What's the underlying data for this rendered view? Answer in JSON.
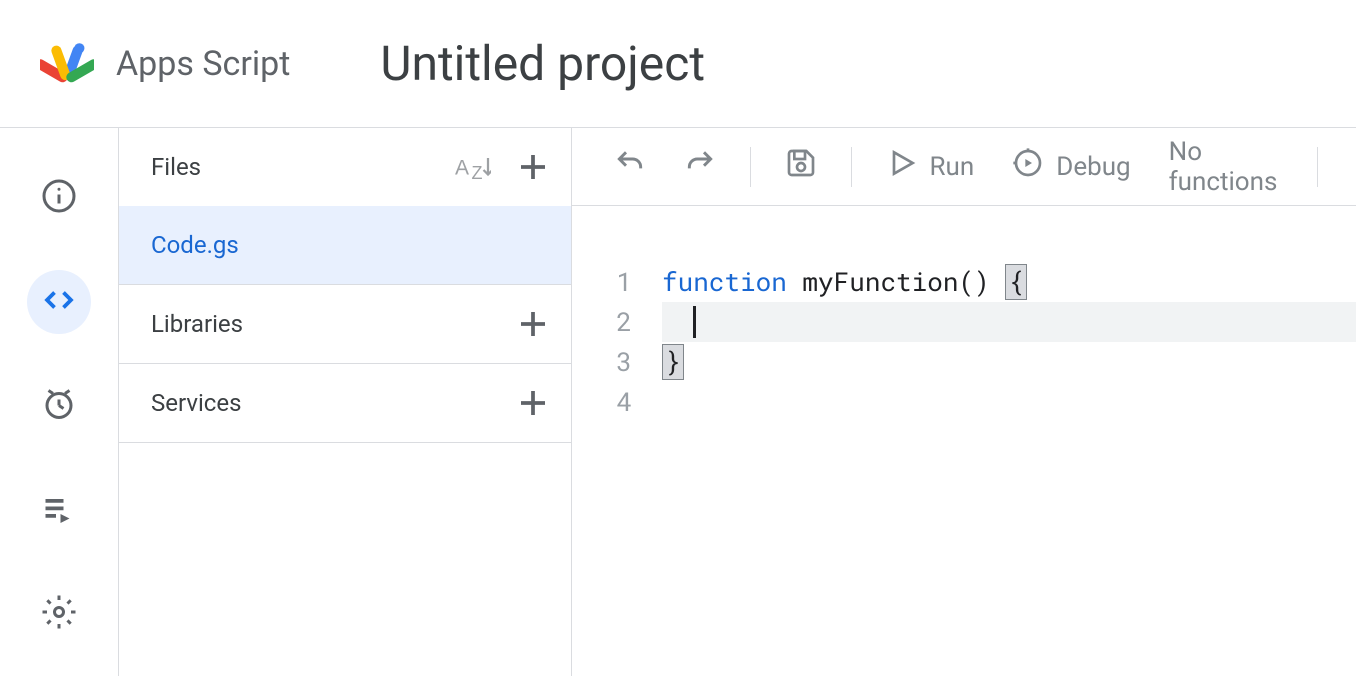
{
  "header": {
    "product_name": "Apps Script",
    "project_title": "Untitled project"
  },
  "leftnav": {
    "items": [
      {
        "name": "overview",
        "icon": "info"
      },
      {
        "name": "editor",
        "icon": "code",
        "active": true
      },
      {
        "name": "triggers",
        "icon": "clock"
      },
      {
        "name": "executions",
        "icon": "playlist"
      },
      {
        "name": "settings",
        "icon": "gear"
      }
    ]
  },
  "sidebar": {
    "files": {
      "title": "Files",
      "items": [
        {
          "name": "Code.gs",
          "selected": true
        }
      ]
    },
    "libraries": {
      "title": "Libraries"
    },
    "services": {
      "title": "Services"
    }
  },
  "toolbar": {
    "run_label": "Run",
    "debug_label": "Debug",
    "function_selector": "No functions"
  },
  "editor": {
    "lines": [
      {
        "n": 1,
        "tokens": [
          {
            "t": "function",
            "c": "kw"
          },
          {
            "t": " myFunction() "
          },
          {
            "t": "{",
            "c": "bracket-hl"
          }
        ]
      },
      {
        "n": 2,
        "tokens": [
          {
            "t": "  "
          }
        ],
        "cursor": true,
        "highlight": true
      },
      {
        "n": 3,
        "tokens": [
          {
            "t": "}",
            "c": "bracket-hl"
          }
        ]
      },
      {
        "n": 4,
        "tokens": []
      }
    ]
  }
}
